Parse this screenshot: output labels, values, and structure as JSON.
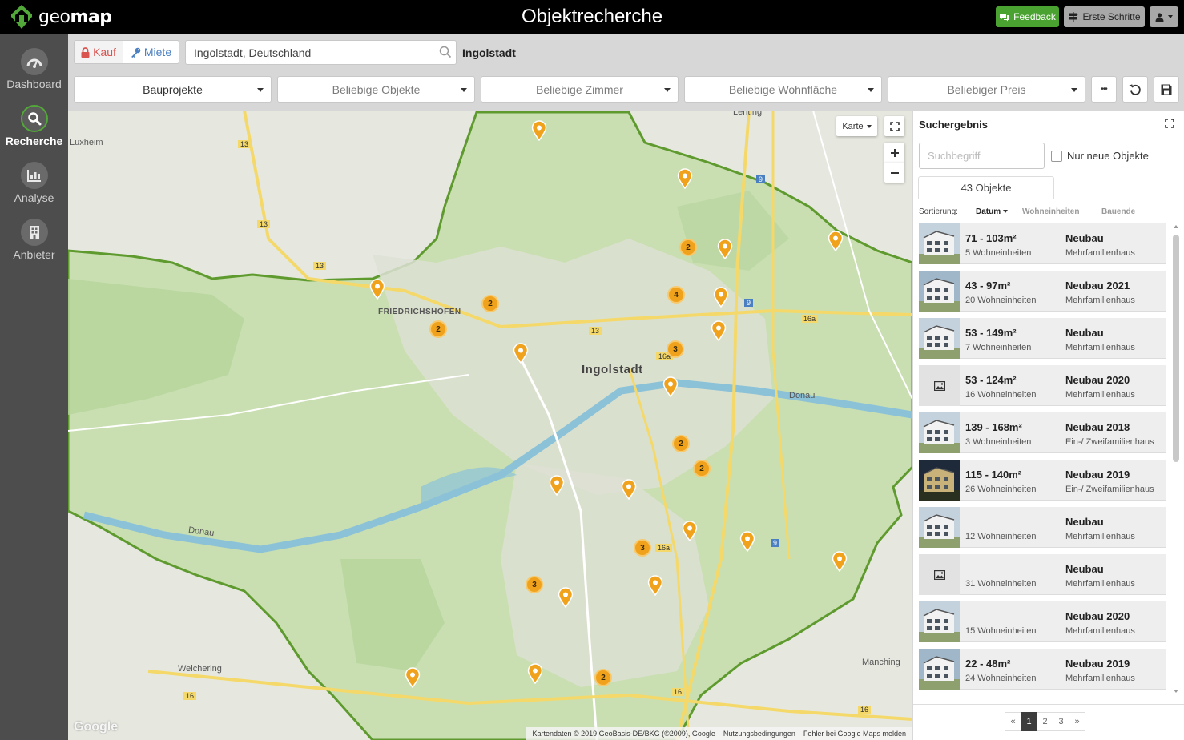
{
  "app": {
    "logo_text_a": "geo",
    "logo_text_b": "map",
    "title": "Objektrecherche"
  },
  "topbar": {
    "feedback_label": "Feedback",
    "first_steps_label": "Erste Schritte"
  },
  "sidebar": {
    "items": [
      {
        "label": "Dashboard"
      },
      {
        "label": "Recherche"
      },
      {
        "label": "Analyse"
      },
      {
        "label": "Anbieter"
      }
    ]
  },
  "filters": {
    "kauf_label": "Kauf",
    "miete_label": "Miete",
    "location_value": "Ingolstadt, Deutschland",
    "location_label": "Ingolstadt",
    "dropdowns": [
      "Bauprojekte",
      "Beliebige Objekte",
      "Beliebige Zimmer",
      "Beliebige Wohnfläche",
      "Beliebiger Preis"
    ],
    "more_label": "•••"
  },
  "map": {
    "map_type_label": "Karte",
    "city_label": "Ingolstadt",
    "district_label": "FRIEDRICHSHOFEN",
    "place_labels": [
      "Lenting",
      "Weichering",
      "Manching",
      "Luxheim",
      "Donau",
      "Donau"
    ],
    "road_labels": [
      "13",
      "13",
      "13",
      "13",
      "9",
      "9",
      "9",
      "16a",
      "16a",
      "16a",
      "16",
      "16",
      "16"
    ],
    "clusters": [
      "2",
      "2",
      "2",
      "4",
      "3",
      "3",
      "2",
      "2",
      "3",
      "2",
      "2"
    ],
    "google_label": "Google",
    "attribution": [
      "Kartendaten © 2019 GeoBasis-DE/BKG (©2009), Google",
      "Nutzungsbedingungen",
      "Fehler bei Google Maps melden"
    ]
  },
  "results": {
    "title": "Suchergebnis",
    "search_placeholder": "Suchbegriff",
    "new_only_label": "Nur neue Objekte",
    "tab_label": "43 Objekte",
    "sort_label": "Sortierung:",
    "sort_options": [
      "Datum",
      "Wohneinheiten",
      "Bauende"
    ],
    "items": [
      {
        "area": "71 - 103m²",
        "units": "5 Wohneinheiten",
        "status": "Neubau",
        "type": "Mehrfamilienhaus",
        "thumb": "photo"
      },
      {
        "area": "43 - 97m²",
        "units": "20 Wohneinheiten",
        "status": "Neubau 2021",
        "type": "Mehrfamilienhaus",
        "thumb": "photo"
      },
      {
        "area": "53 - 149m²",
        "units": "7 Wohneinheiten",
        "status": "Neubau",
        "type": "Mehrfamilienhaus",
        "thumb": "photo"
      },
      {
        "area": "53 - 124m²",
        "units": "16 Wohneinheiten",
        "status": "Neubau 2020",
        "type": "Mehrfamilienhaus",
        "thumb": "placeholder"
      },
      {
        "area": "139 - 168m²",
        "units": "3 Wohneinheiten",
        "status": "Neubau 2018",
        "type": "Ein-/ Zweifamilienhaus",
        "thumb": "photo"
      },
      {
        "area": "115 - 140m²",
        "units": "26 Wohneinheiten",
        "status": "Neubau 2019",
        "type": "Ein-/ Zweifamilienhaus",
        "thumb": "photo"
      },
      {
        "area": "",
        "units": "12 Wohneinheiten",
        "status": "Neubau",
        "type": "Mehrfamilienhaus",
        "thumb": "photo"
      },
      {
        "area": "",
        "units": "31 Wohneinheiten",
        "status": "Neubau",
        "type": "Mehrfamilienhaus",
        "thumb": "placeholder"
      },
      {
        "area": "",
        "units": "15 Wohneinheiten",
        "status": "Neubau 2020",
        "type": "Mehrfamilienhaus",
        "thumb": "photo"
      },
      {
        "area": "22 - 48m²",
        "units": "24 Wohneinheiten",
        "status": "Neubau 2019",
        "type": "Mehrfamilienhaus",
        "thumb": "photo"
      }
    ],
    "pagination": [
      "«",
      "1",
      "2",
      "3",
      "»"
    ],
    "current_page": "1"
  },
  "colors": {
    "accent_green": "#52a838",
    "feedback_green": "#4aa331",
    "marker_orange": "#f0a21c",
    "boundary_green": "#5e9a2e",
    "river_blue": "#8cc2d8",
    "kauf_red": "#d9534f",
    "miete_blue": "#4a7fc1"
  }
}
